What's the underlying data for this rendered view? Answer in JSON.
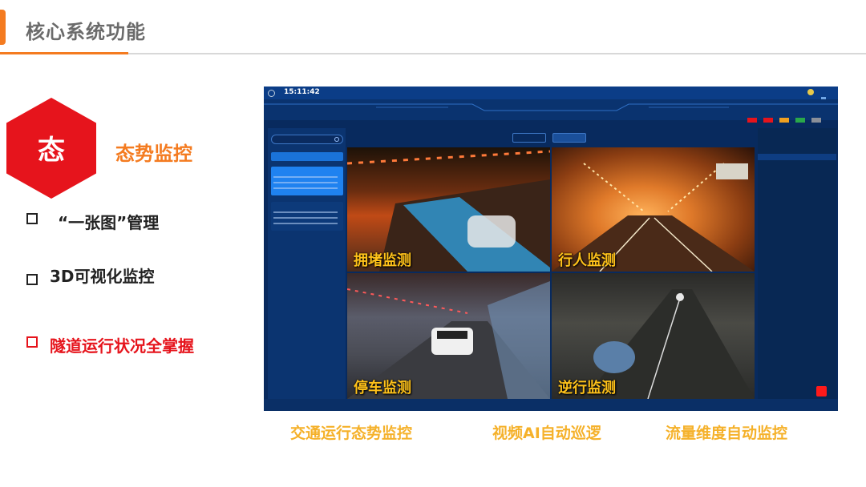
{
  "header": {
    "title": "核心系统功能"
  },
  "section": {
    "hex_char": "态",
    "title": "态势监控"
  },
  "bullets": [
    {
      "text": "“一张图”管理"
    },
    {
      "text": "3D可视化监控"
    },
    {
      "text": "隧道运行状况全掌握"
    }
  ],
  "dashboard": {
    "clock": "15:11:42",
    "video_labels": [
      "拥堵监测",
      "行人监测",
      "停车监测",
      "逆行监测"
    ],
    "red_button_color": "#ff1a1a"
  },
  "captions": [
    "交通运行态势监控",
    "视频AI自动巡逻",
    "流量维度自动监控"
  ],
  "colors": {
    "accent": "#f47b20",
    "red": "#e6141c",
    "gold": "#f5b12a",
    "dashboard_bg": "#082a5e"
  }
}
